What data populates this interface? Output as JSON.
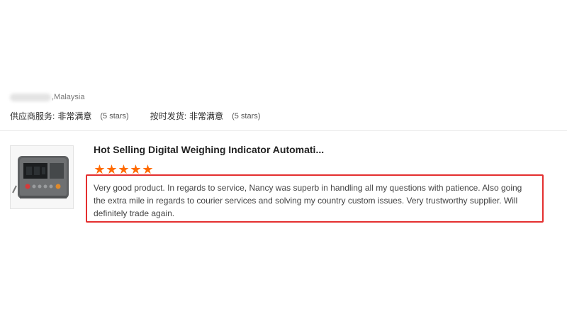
{
  "reviewer": {
    "country": ",Malaysia"
  },
  "ratings": [
    {
      "label": "供应商服务:",
      "value": "非常满意",
      "stars": "(5 stars)"
    },
    {
      "label": "按时发货:",
      "value": "非常满意",
      "stars": "(5 stars)"
    }
  ],
  "product": {
    "title": "Hot Selling Digital Weighing Indicator Automati...",
    "rating": 5,
    "rating_max": 5
  },
  "review": {
    "text": "Very good product. In regards to service, Nancy was superb in handling all my questions with patience. Also going the extra mile in regards to courier services and solving my country custom issues. Very trustworthy supplier. Will definitely trade again."
  },
  "colors": {
    "accent": "#ff6a00",
    "highlight_border": "#e42f2f"
  }
}
